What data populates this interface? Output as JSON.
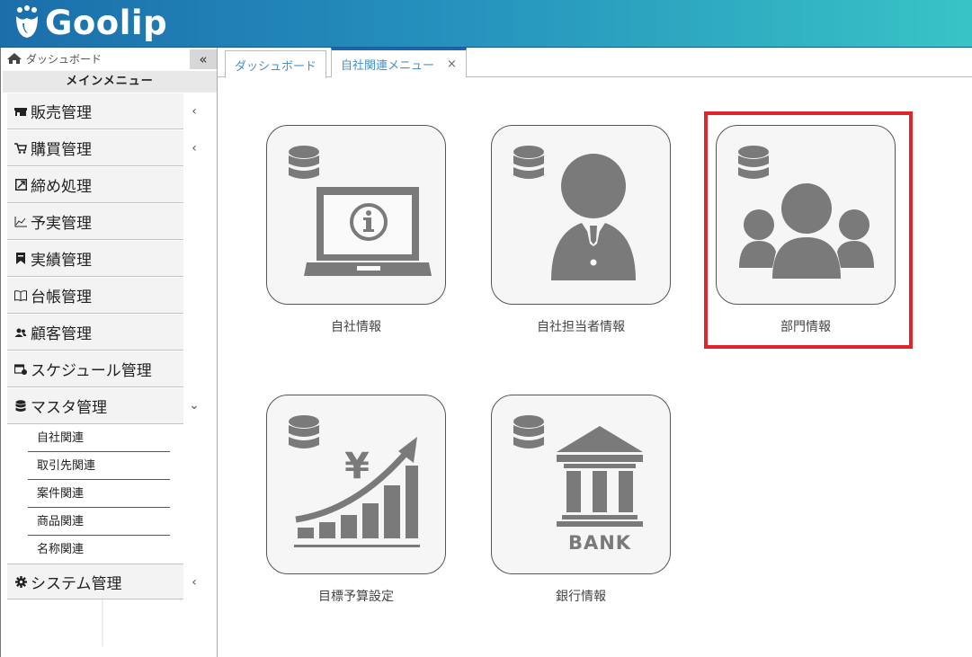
{
  "app": {
    "logo_text": "Goolip"
  },
  "sidebar": {
    "dashboard_link": "ダッシュボード",
    "collapse_label": "«",
    "menu_title": "メインメニュー",
    "items": [
      {
        "label": "販売管理",
        "icon": "store-icon",
        "chevron": "‹"
      },
      {
        "label": "購買管理",
        "icon": "cart-icon",
        "chevron": "‹"
      },
      {
        "label": "締め処理",
        "icon": "close-process-icon",
        "chevron": ""
      },
      {
        "label": "予実管理",
        "icon": "line-chart-icon",
        "chevron": ""
      },
      {
        "label": "実績管理",
        "icon": "bookmark-icon",
        "chevron": ""
      },
      {
        "label": "台帳管理",
        "icon": "book-icon",
        "chevron": ""
      },
      {
        "label": "顧客管理",
        "icon": "users-icon",
        "chevron": ""
      },
      {
        "label": "スケジュール管理",
        "icon": "calendar-icon",
        "chevron": ""
      },
      {
        "label": "マスタ管理",
        "icon": "database-icon",
        "chevron": "⌄"
      }
    ],
    "sub_items": [
      "自社関連",
      "取引先関連",
      "案件関連",
      "商品関連",
      "名称関連"
    ],
    "system_item": {
      "label": "システム管理",
      "icon": "gear-icon",
      "chevron": "‹"
    }
  },
  "tabs": [
    {
      "label": "ダッシュボード",
      "active": false
    },
    {
      "label": "自社関連メニュー",
      "active": true,
      "close": "×"
    }
  ],
  "tiles": [
    {
      "label": "自社情報",
      "icon": "company-info-icon"
    },
    {
      "label": "自社担当者情報",
      "icon": "staff-icon"
    },
    {
      "label": "部門情報",
      "icon": "department-icon",
      "highlighted": true
    },
    {
      "label": "目標予算設定",
      "icon": "budget-growth-icon",
      "yen": "¥"
    },
    {
      "label": "銀行情報",
      "icon": "bank-icon",
      "bank_text": "BANK"
    }
  ],
  "colors": {
    "accent": "#1565c0",
    "highlight": "#e0242c",
    "icon_gray": "#7a7a7a"
  }
}
